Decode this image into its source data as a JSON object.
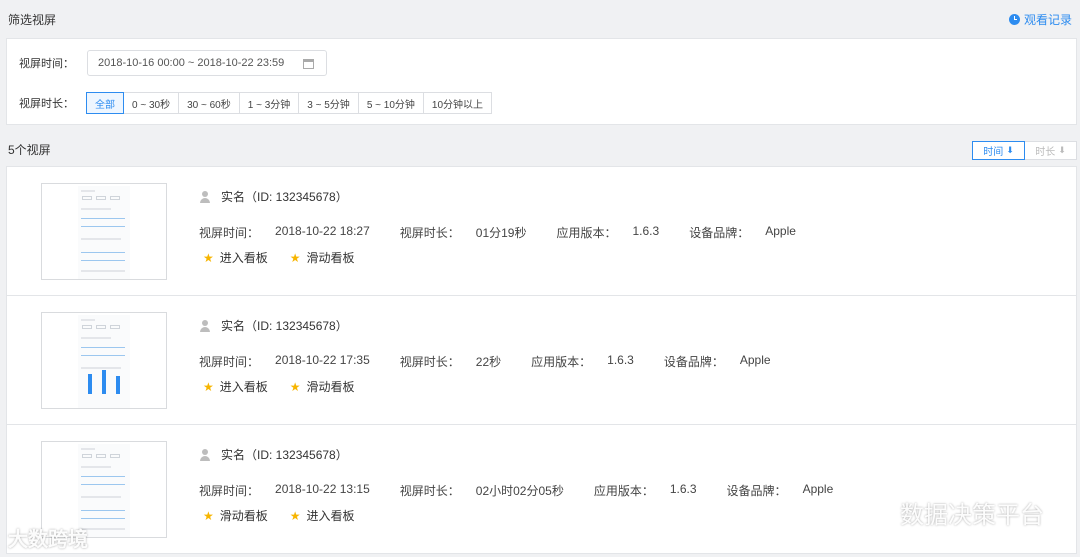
{
  "header": {
    "title": "筛选视屏",
    "watch_record": "观看记录"
  },
  "filters": {
    "time_label": "视屏时间：",
    "date_range": "2018-10-16 00:00  ~ 2018-10-22 23:59",
    "duration_label": "视屏时长：",
    "duration_options": [
      "全部",
      "0 ~ 30秒",
      "30 ~ 60秒",
      "1 ~ 3分钟",
      "3 ~ 5分钟",
      "5 ~ 10分钟",
      "10分钟以上"
    ],
    "duration_selected": "全部"
  },
  "list": {
    "count_label": "5个视屏",
    "sort": [
      {
        "label": "时间",
        "active": true
      },
      {
        "label": "时长",
        "active": false
      }
    ],
    "items": [
      {
        "user": "实名（ID: 132345678）",
        "meta": [
          {
            "label": "视屏时间：",
            "value": "2018-10-22 18:27"
          },
          {
            "label": "视屏时长：",
            "value": "01分19秒"
          },
          {
            "label": "应用版本：",
            "value": "1.6.3"
          },
          {
            "label": "设备品牌：",
            "value": "Apple"
          }
        ],
        "actions": [
          "进入看板",
          "滑动看板"
        ]
      },
      {
        "user": "实名（ID: 132345678）",
        "meta": [
          {
            "label": "视屏时间：",
            "value": "2018-10-22 17:35"
          },
          {
            "label": "视屏时长：",
            "value": "22秒"
          },
          {
            "label": "应用版本：",
            "value": "1.6.3"
          },
          {
            "label": "设备品牌：",
            "value": "Apple"
          }
        ],
        "actions": [
          "进入看板",
          "滑动看板"
        ]
      },
      {
        "user": "实名（ID: 132345678）",
        "meta": [
          {
            "label": "视屏时间：",
            "value": "2018-10-22 13:15"
          },
          {
            "label": "视屏时长：",
            "value": "02小时02分05秒"
          },
          {
            "label": "应用版本：",
            "value": "1.6.3"
          },
          {
            "label": "设备品牌：",
            "value": "Apple"
          }
        ],
        "actions": [
          "滑动看板",
          "进入看板"
        ]
      }
    ]
  },
  "watermarks": {
    "left": "大数跨境",
    "right": "数据决策平台"
  },
  "colors": {
    "accent": "#2d8cf0",
    "star": "#f7b500"
  }
}
